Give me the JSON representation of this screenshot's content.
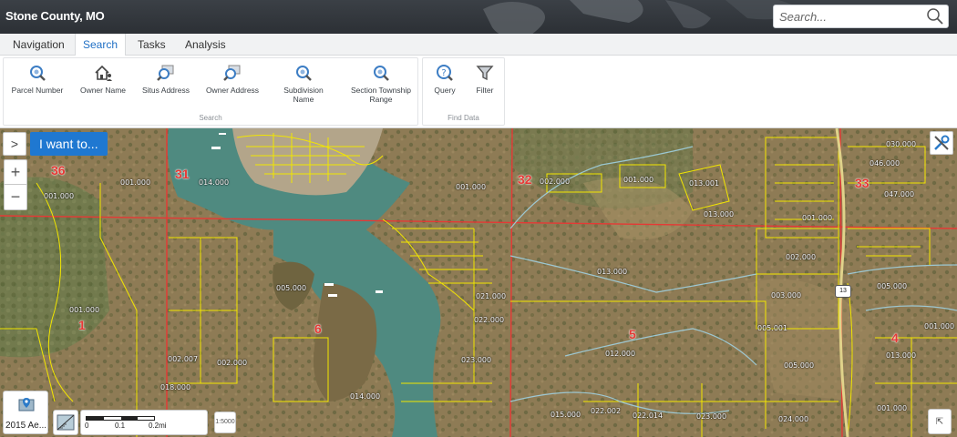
{
  "app": {
    "title": "Stone County, MO"
  },
  "search": {
    "placeholder": "Search..."
  },
  "tabs": [
    {
      "label": "Navigation",
      "active": false
    },
    {
      "label": "Search",
      "active": true
    },
    {
      "label": "Tasks",
      "active": false
    },
    {
      "label": "Analysis",
      "active": false
    }
  ],
  "ribbon": {
    "search_group": {
      "label": "Search",
      "tools": [
        {
          "label": "Parcel Number",
          "icon": "magnifier-icon"
        },
        {
          "label": "Owner Name",
          "icon": "owner-house-icon"
        },
        {
          "label": "Situs Address",
          "icon": "map-search-icon"
        },
        {
          "label": "Owner Address",
          "icon": "map-search-icon"
        },
        {
          "label": "Subdivision Name",
          "icon": "magnifier-icon"
        },
        {
          "label": "Section Township Range",
          "icon": "magnifier-icon"
        }
      ]
    },
    "find_group": {
      "label": "Find Data",
      "tools": [
        {
          "label": "Query",
          "icon": "query-icon"
        },
        {
          "label": "Filter",
          "icon": "filter-icon"
        }
      ]
    }
  },
  "map": {
    "i_want_to": "I want to...",
    "basemap_label": "2015 Ae...",
    "scale_ticks": [
      "0",
      "0.1",
      "0.2mi"
    ],
    "scale_text": "1:5000",
    "route_shield": "13",
    "sections": [
      "36",
      "31",
      "32",
      "33",
      "1",
      "6",
      "5",
      "4"
    ],
    "parcels": [
      "001.000",
      "014.000",
      "001.000",
      "002.000",
      "001.000",
      "013.001",
      "013.000",
      "030.000",
      "046.000",
      "047.000",
      "001.000",
      "001.000",
      "002.000",
      "005.000",
      "013.000",
      "021.000",
      "022.000",
      "003.000",
      "005.000",
      "005.001",
      "001.000",
      "023.000",
      "012.000",
      "002.007",
      "002.000",
      "018.000",
      "005.000",
      "013.000",
      "014.000",
      "015.000",
      "022.002",
      "022.014",
      "023.000",
      "024.000",
      "001.000",
      "001.000"
    ]
  },
  "colors": {
    "titlebar": "#2f3338",
    "accent": "#1f78d1",
    "section_line": "#e53935",
    "parcel_line": "#f2e600",
    "water": "#4f8a80"
  }
}
